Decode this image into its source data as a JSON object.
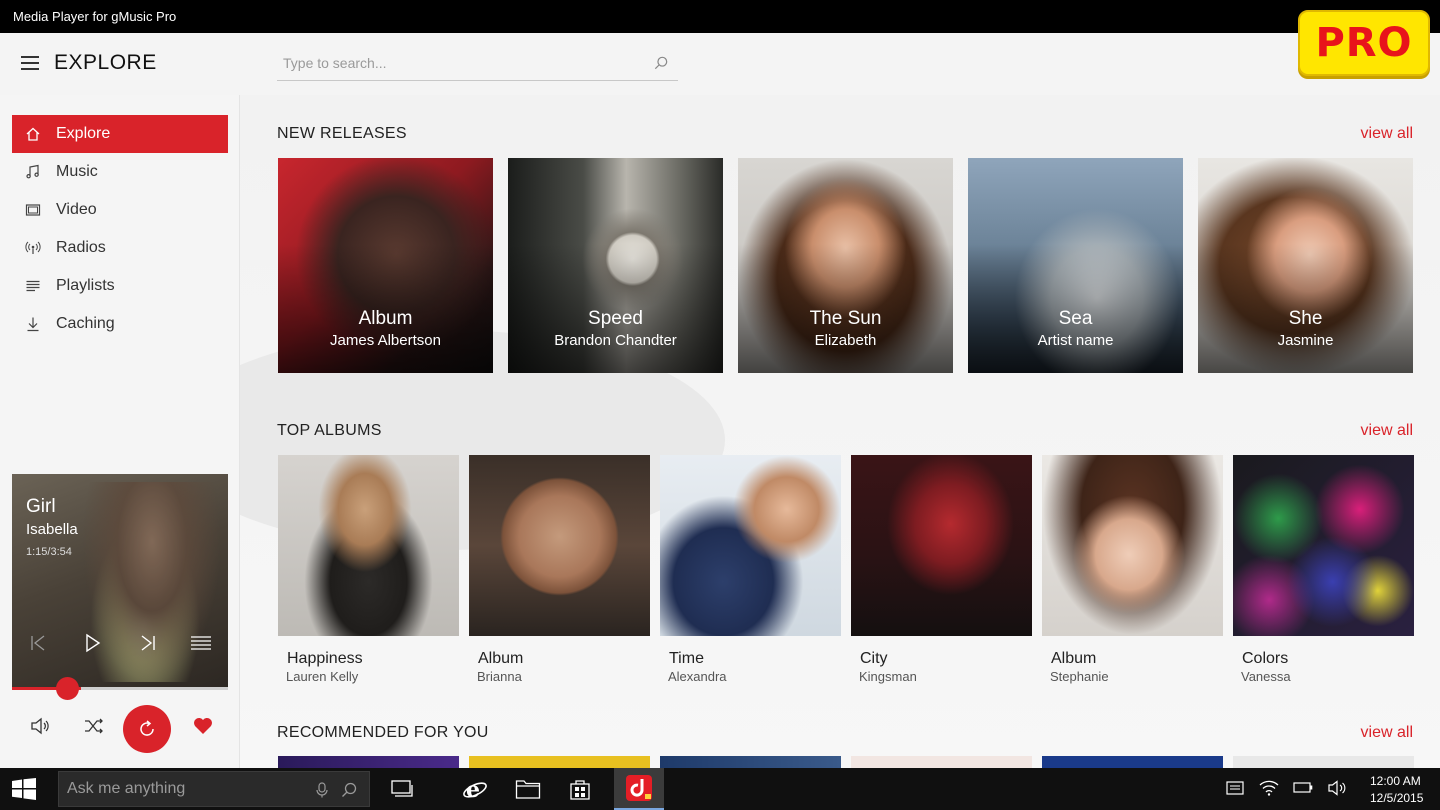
{
  "window": {
    "title": "Media Player for gMusic Pro"
  },
  "badge": {
    "label": "PRO"
  },
  "header": {
    "title": "EXPLORE",
    "search_placeholder": "Type to search..."
  },
  "sidebar": {
    "items": [
      {
        "label": "Explore",
        "icon": "home-icon"
      },
      {
        "label": "Music",
        "icon": "music-notes-icon"
      },
      {
        "label": "Video",
        "icon": "video-icon"
      },
      {
        "label": "Radios",
        "icon": "radio-antenna-icon"
      },
      {
        "label": "Playlists",
        "icon": "playlist-icon"
      },
      {
        "label": "Caching",
        "icon": "download-icon"
      }
    ]
  },
  "now_playing": {
    "title": "Girl",
    "artist": "Isabella",
    "time": "1:15/3:54",
    "progress_fraction": 0.32
  },
  "sections": {
    "new_releases": {
      "title": "NEW RELEASES",
      "view_all": "view all",
      "items": [
        {
          "title": "Album",
          "artist": "James Albertson"
        },
        {
          "title": "Speed",
          "artist": "Brandon Chandter"
        },
        {
          "title": "The Sun",
          "artist": "Elizabeth"
        },
        {
          "title": "Sea",
          "artist": "Artist name"
        },
        {
          "title": "She",
          "artist": "Jasmine"
        }
      ]
    },
    "top_albums": {
      "title": "TOP ALBUMS",
      "view_all": "view all",
      "items": [
        {
          "title": "Happiness",
          "artist": "Lauren Kelly"
        },
        {
          "title": "Album",
          "artist": "Brianna"
        },
        {
          "title": "Time",
          "artist": "Alexandra"
        },
        {
          "title": "City",
          "artist": "Kingsman"
        },
        {
          "title": "Album",
          "artist": "Stephanie"
        },
        {
          "title": "Colors",
          "artist": "Vanessa"
        }
      ]
    },
    "recommended": {
      "title": "RECOMMENDED FOR YOU",
      "view_all": "view all"
    }
  },
  "taskbar": {
    "search_placeholder": "Ask me anything",
    "time": "12:00 AM",
    "date": "12/5/2015"
  },
  "colors": {
    "accent": "#d9232a",
    "badge": "#ffe600"
  }
}
